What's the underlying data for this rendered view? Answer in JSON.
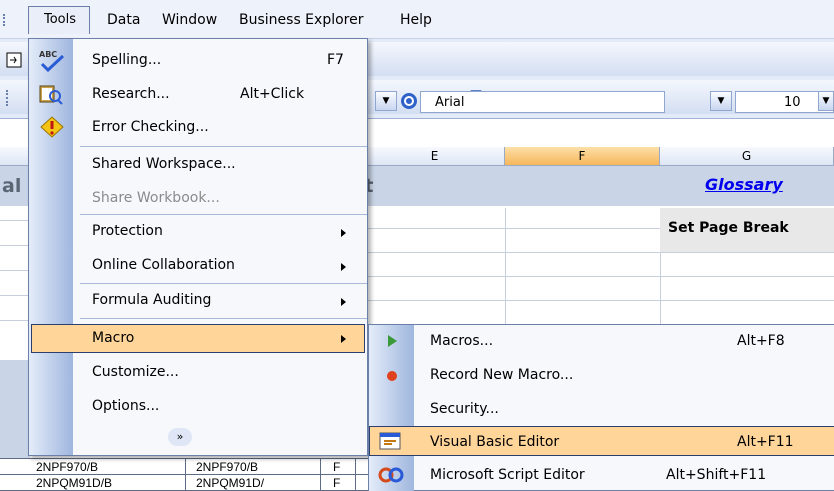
{
  "menubar": {
    "items": [
      "Tools",
      "Data",
      "Window",
      "Business Explorer",
      "Help"
    ]
  },
  "toolbar": {
    "font": "Arial",
    "font_size": "10"
  },
  "sheet": {
    "columns": [
      "E",
      "F",
      "G"
    ],
    "title_fragment_left": "al",
    "title_fragment": "rt",
    "glossary_link": "Glossary",
    "set_page_break": "Set Page Break",
    "rows": [
      [
        "2NPF970/B",
        "2NPF970/B",
        "F"
      ],
      [
        "2NPQM91D/B",
        "2NPQM91D/",
        "F"
      ]
    ]
  },
  "tools_menu": {
    "items": [
      {
        "label": "Spelling...",
        "shortcut": "F7",
        "icon": "spelling-abc-icon"
      },
      {
        "label": "Research...",
        "shortcut": "Alt+Click",
        "icon": "research-book-icon"
      },
      {
        "label": "Error Checking...",
        "icon": "error-check-diamond-icon"
      },
      {
        "label": "Shared Workspace..."
      },
      {
        "label": "Share Workbook...",
        "disabled": true
      },
      {
        "label": "Protection",
        "submenu": true
      },
      {
        "label": "Online Collaboration",
        "submenu": true
      },
      {
        "label": "Formula Auditing",
        "submenu": true
      },
      {
        "label": "Macro",
        "submenu": true,
        "highlighted": true
      },
      {
        "label": "Customize..."
      },
      {
        "label": "Options..."
      }
    ],
    "more_glyph": "»"
  },
  "macro_submenu": {
    "items": [
      {
        "label": "Macros...",
        "shortcut": "Alt+F8",
        "icon": "play-triangle-icon"
      },
      {
        "label": "Record New Macro...",
        "icon": "record-dot-icon"
      },
      {
        "label": "Security..."
      },
      {
        "label": "Visual Basic Editor",
        "shortcut": "Alt+F11",
        "icon": "vb-editor-icon",
        "highlighted": true
      },
      {
        "label": "Microsoft Script Editor",
        "shortcut": "Alt+Shift+F11",
        "icon": "script-editor-icon"
      }
    ]
  },
  "colors": {
    "menu_highlight": "#ffd59a",
    "menu_border": "#6b7fa8",
    "link": "#0000ee"
  }
}
